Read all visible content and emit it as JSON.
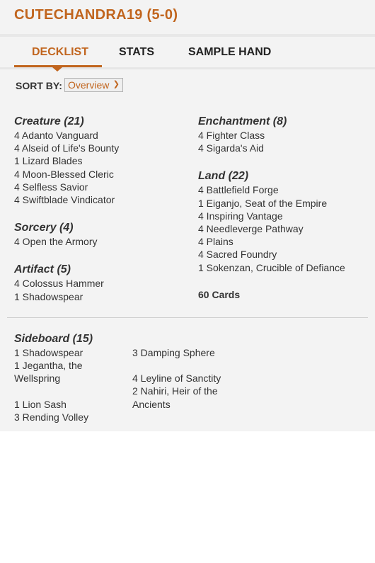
{
  "header": {
    "title": "CUTECHANDRA19 (5-0)"
  },
  "tabs": [
    {
      "label": "DECKLIST",
      "active": true
    },
    {
      "label": "STATS",
      "active": false
    },
    {
      "label": "SAMPLE HAND",
      "active": false
    }
  ],
  "sort": {
    "label": "SORT BY:",
    "value": "Overview"
  },
  "left": {
    "creature": {
      "title": "Creature (21)",
      "cards": [
        "4 Adanto Vanguard",
        "4 Alseid of Life's Bounty",
        "1 Lizard Blades",
        "4 Moon-Blessed Cleric",
        "4 Selfless Savior",
        "4 Swiftblade Vindicator"
      ]
    },
    "sorcery": {
      "title": "Sorcery (4)",
      "cards": [
        "4 Open the Armory"
      ]
    },
    "artifact": {
      "title": "Artifact (5)",
      "cards": [
        "4 Colossus Hammer",
        "1 Shadowspear"
      ]
    }
  },
  "right": {
    "enchantment": {
      "title": "Enchantment (8)",
      "cards": [
        "4 Fighter Class",
        "4 Sigarda's Aid"
      ]
    },
    "land": {
      "title": "Land (22)",
      "cards": [
        "4 Battlefield Forge",
        "1 Eiganjo, Seat of the Empire",
        "4 Inspiring Vantage",
        "4 Needleverge Pathway",
        "4 Plains",
        "4 Sacred Foundry",
        "1 Sokenzan, Crucible of Defiance"
      ]
    },
    "total": "60 Cards"
  },
  "sideboard": {
    "title": "Sideboard (15)",
    "col1": [
      "1 Shadowspear",
      "1 Jegantha, the Wellspring",
      "1 Lion Sash",
      "3 Rending Volley"
    ],
    "col2": [
      "3 Damping Sphere",
      "4 Leyline of Sanctity",
      "2 Nahiri, Heir of the Ancients"
    ]
  },
  "colors": {
    "accent": "#c1651e",
    "panel": "#f3f3f3"
  }
}
